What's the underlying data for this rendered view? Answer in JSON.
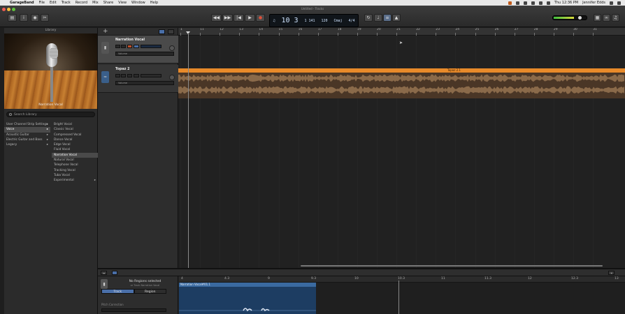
{
  "menubar": {
    "apple": "",
    "app": "GarageBand",
    "items": [
      "File",
      "Edit",
      "Track",
      "Record",
      "Mix",
      "Share",
      "View",
      "Window",
      "Help"
    ],
    "clock": "Thu 12:36 PM",
    "user": "Jennifer Edds"
  },
  "window": {
    "title": "Untitled - Tracks",
    "lcd": {
      "position": "10 3",
      "beat": "1 141",
      "tempo": "120",
      "key": "Cmaj",
      "signature": "4/4"
    }
  },
  "library": {
    "title": "Library",
    "preset_name": "Narration Vocal",
    "search_placeholder": "Search Library",
    "categories": [
      {
        "label": "User Channel Strip Settings"
      },
      {
        "label": "Voice"
      },
      {
        "label": "Acoustic Guitar"
      },
      {
        "label": "Electric Guitar and Bass"
      },
      {
        "label": "Legacy"
      }
    ],
    "presets": [
      {
        "label": "Bright Vocal"
      },
      {
        "label": "Classic Vocal"
      },
      {
        "label": "Compressed Vocal"
      },
      {
        "label": "Dance Vocal"
      },
      {
        "label": "Edge Vocal"
      },
      {
        "label": "Fluid Vocal"
      },
      {
        "label": "Narration Vocal"
      },
      {
        "label": "Natural Vocal"
      },
      {
        "label": "Telephone Vocal"
      },
      {
        "label": "Tracking Vocal"
      },
      {
        "label": "Tuba Vocal"
      },
      {
        "label": "Experimental"
      }
    ]
  },
  "tracks": [
    {
      "name": "Narration Vocal",
      "volume_label": "Volume"
    },
    {
      "name": "Topaz 2",
      "volume_label": "Volume"
    }
  ],
  "ruler": [
    "1",
    "11",
    "12",
    "13",
    "14",
    "15",
    "16",
    "17",
    "18",
    "19",
    "20",
    "21",
    "22",
    "23",
    "24",
    "25",
    "26",
    "27",
    "28",
    "29",
    "30",
    "31"
  ],
  "region": {
    "name": "Topaz 2.1"
  },
  "editor": {
    "no_region": "No Regions selected",
    "sub": "or Track Narration Vocal",
    "tab_track": "Track",
    "tab_region": "Region",
    "pitch_label": "Pitch Correction",
    "ruler": [
      "4",
      "4.3",
      "9",
      "9.3",
      "10",
      "10.3",
      "11",
      "11.3",
      "12",
      "12.3",
      "13"
    ],
    "region_name": "Narration Vocal#01.1"
  }
}
